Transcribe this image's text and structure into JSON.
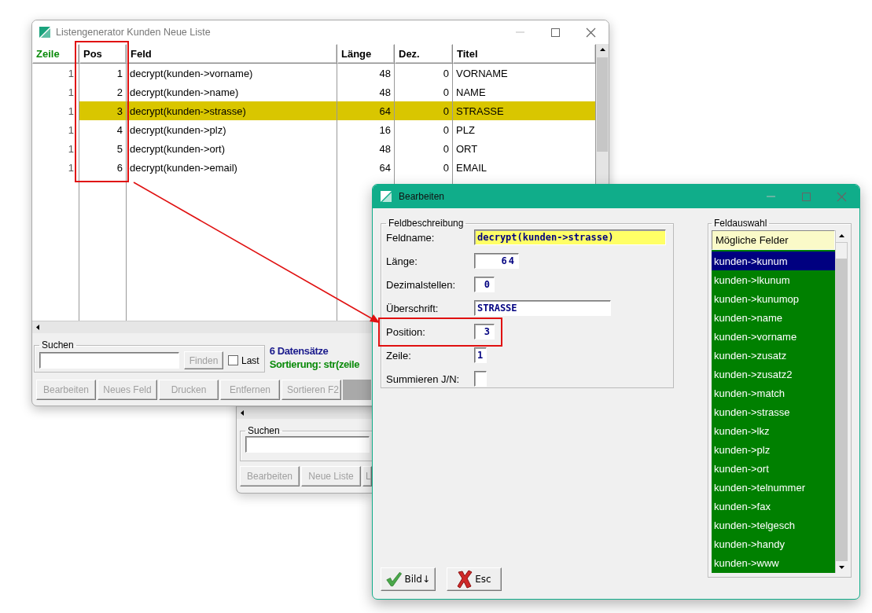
{
  "main_window": {
    "title": "Listengenerator Kunden Neue Liste",
    "columns": [
      {
        "label": "Zeile",
        "sorted": true
      },
      {
        "label": "Pos",
        "sorted": false
      },
      {
        "label": "Feld",
        "sorted": false
      },
      {
        "label": "Länge",
        "sorted": false
      },
      {
        "label": "Dez.",
        "sorted": false
      },
      {
        "label": "Titel",
        "sorted": false
      }
    ],
    "rows": [
      {
        "cells": [
          "1",
          "1",
          "decrypt(kunden->vorname)",
          "48",
          "0",
          "VORNAME"
        ],
        "selected": false
      },
      {
        "cells": [
          "1",
          "2",
          "decrypt(kunden->name)",
          "48",
          "0",
          "NAME"
        ],
        "selected": false
      },
      {
        "cells": [
          "1",
          "3",
          "decrypt(kunden->strasse)",
          "64",
          "0",
          "STRASSE"
        ],
        "selected": true
      },
      {
        "cells": [
          "1",
          "4",
          "decrypt(kunden->plz)",
          "16",
          "0",
          "PLZ"
        ],
        "selected": false
      },
      {
        "cells": [
          "1",
          "5",
          "decrypt(kunden->ort)",
          "48",
          "0",
          "ORT"
        ],
        "selected": false
      },
      {
        "cells": [
          "1",
          "6",
          "decrypt(kunden->email)",
          "64",
          "0",
          "EMAIL"
        ],
        "selected": false
      }
    ],
    "search": {
      "label": "Suchen",
      "button": {
        "label": "Finden",
        "disabled": true
      },
      "last": {
        "label": "Last",
        "checked": false
      }
    },
    "record_count": "6 Datensätze",
    "sorting": "Sortierung: str(zeile",
    "buttons": [
      {
        "label": "Bearbeiten",
        "disabled": true
      },
      {
        "label": "Neues Feld",
        "disabled": true
      },
      {
        "label": "Drucken",
        "disabled": true
      },
      {
        "label": "Entfernen",
        "disabled": true
      },
      {
        "label": "Sortieren F2",
        "disabled": true
      }
    ]
  },
  "back_window": {
    "search_label": "Suchen",
    "buttons": [
      {
        "label": "Bearbeiten",
        "disabled": true
      },
      {
        "label": "Neue Liste",
        "disabled": true
      },
      {
        "label": "L",
        "disabled": true
      }
    ]
  },
  "dialog": {
    "title": "Bearbeiten",
    "group": "Feldbeschreibung",
    "fields": [
      {
        "label": "Feldname:",
        "value": "decrypt(kunden->strasse)",
        "kind": "text",
        "focused": true
      },
      {
        "label": "Länge:",
        "value": "64",
        "kind": "text",
        "focused": false
      },
      {
        "label": "Dezimalstellen:",
        "value": "0",
        "kind": "text",
        "focused": false
      },
      {
        "label": "Überschrift:",
        "value": "STRASSE",
        "kind": "text",
        "focused": false
      },
      {
        "label": "Position:",
        "value": "3",
        "kind": "text",
        "focused": false
      },
      {
        "label": "Zeile:",
        "value": "1",
        "kind": "text",
        "focused": false
      },
      {
        "label": "Summieren J/N:",
        "kind": "checkbox",
        "checked": false
      }
    ],
    "list_group": "Feldauswahl",
    "list_header": "Mögliche Felder",
    "items": [
      {
        "label": "kunden->kunum",
        "selected": true
      },
      {
        "label": "kunden->lkunum",
        "selected": false
      },
      {
        "label": "kunden->kunumop",
        "selected": false
      },
      {
        "label": "kunden->name",
        "selected": false
      },
      {
        "label": "kunden->vorname",
        "selected": false
      },
      {
        "label": "kunden->zusatz",
        "selected": false
      },
      {
        "label": "kunden->zusatz2",
        "selected": false
      },
      {
        "label": "kunden->match",
        "selected": false
      },
      {
        "label": "kunden->strasse",
        "selected": false
      },
      {
        "label": "kunden->lkz",
        "selected": false
      },
      {
        "label": "kunden->plz",
        "selected": false
      },
      {
        "label": "kunden->ort",
        "selected": false
      },
      {
        "label": "kunden->telnummer",
        "selected": false
      },
      {
        "label": "kunden->fax",
        "selected": false
      },
      {
        "label": "kunden->telgesch",
        "selected": false
      },
      {
        "label": "kunden->handy",
        "selected": false
      },
      {
        "label": "kunden->www",
        "selected": false
      }
    ],
    "buttons": [
      {
        "label": "Bild↓",
        "kind": "ok"
      },
      {
        "label": "Esc",
        "kind": "cancel"
      }
    ]
  }
}
